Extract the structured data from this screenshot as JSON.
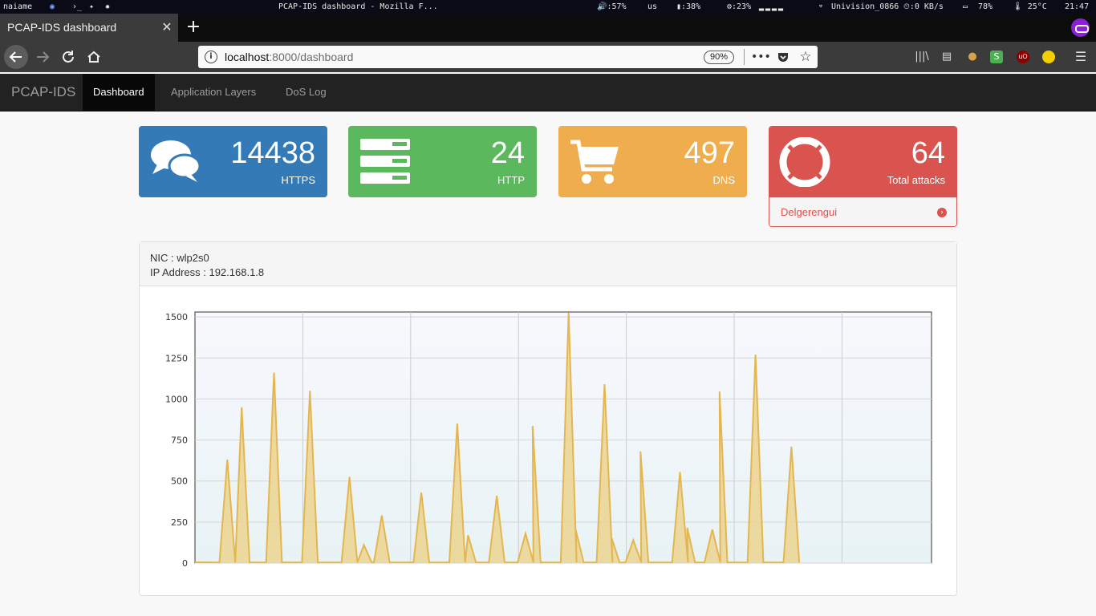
{
  "system_bar": {
    "user": "naiame",
    "window_title": "PCAP-IDS dashboard - Mozilla F...",
    "volume": "🔊:57%",
    "keyboard": "us",
    "memory": "▮:38%",
    "cpu": "⚙:23%",
    "wifi": "Univision_0866",
    "net_speed": "⏲:0 KB/s",
    "battery": "78%",
    "temp": "🌡 25°C",
    "clock": "21:47"
  },
  "browser": {
    "tab_title": "PCAP-IDS dashboard",
    "url_host": "localhost",
    "url_rest": ":8000/dashboard",
    "zoom": "90%"
  },
  "app": {
    "brand": "PCAP-IDS",
    "nav": [
      {
        "label": "Dashboard",
        "active": true
      },
      {
        "label": "Application Layers",
        "active": false
      },
      {
        "label": "DoS Log",
        "active": false
      }
    ]
  },
  "stats": [
    {
      "value": "14438",
      "label": "HTTPS",
      "color": "#337ab7",
      "icon": "comments-icon"
    },
    {
      "value": "24",
      "label": "HTTP",
      "color": "#5cb85c",
      "icon": "server-icon"
    },
    {
      "value": "497",
      "label": "DNS",
      "color": "#f0ad4e",
      "icon": "shopping-cart-icon"
    },
    {
      "value": "64",
      "label": "Total attacks",
      "color": "#d9534f",
      "icon": "life-ring-icon",
      "footer": "Delgerengui"
    }
  ],
  "interface": {
    "nic": "NIC : wlp2s0",
    "ip": "IP Address : 192.168.1.8"
  },
  "chart_data": {
    "type": "area",
    "y_ticks": [
      "1500",
      "1250",
      "1000",
      "750",
      "500",
      "250",
      "0"
    ],
    "ylim": [
      0,
      1530
    ],
    "xlim": [
      0,
      205
    ],
    "line_color": "#e4b650",
    "fill_color": "#ecd48f",
    "grid": true,
    "peaks": [
      {
        "x": 9,
        "y": 630
      },
      {
        "x": 13,
        "y": 950
      },
      {
        "x": 22,
        "y": 1160
      },
      {
        "x": 32,
        "y": 1050
      },
      {
        "x": 43,
        "y": 525
      },
      {
        "x": 47,
        "y": 110
      },
      {
        "x": 52,
        "y": 290
      },
      {
        "x": 63,
        "y": 430
      },
      {
        "x": 73,
        "y": 850
      },
      {
        "x": 76,
        "y": 170
      },
      {
        "x": 84,
        "y": 410
      },
      {
        "x": 92,
        "y": 180
      },
      {
        "x": 94,
        "y": 835
      },
      {
        "x": 104,
        "y": 1525
      },
      {
        "x": 106,
        "y": 200
      },
      {
        "x": 114,
        "y": 1090
      },
      {
        "x": 116,
        "y": 150
      },
      {
        "x": 122,
        "y": 140
      },
      {
        "x": 124,
        "y": 680
      },
      {
        "x": 135,
        "y": 555
      },
      {
        "x": 137,
        "y": 215
      },
      {
        "x": 144,
        "y": 205
      },
      {
        "x": 146,
        "y": 1045
      },
      {
        "x": 156,
        "y": 1270
      },
      {
        "x": 166,
        "y": 710
      }
    ],
    "data_end_x": 211
  }
}
